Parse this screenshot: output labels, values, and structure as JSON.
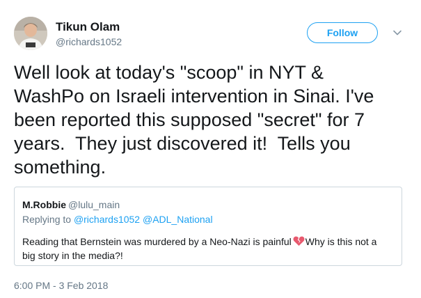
{
  "author": {
    "display_name": "Tikun Olam",
    "handle": "@richards1052",
    "avatar_icon": "profile-photo"
  },
  "actions": {
    "follow_label": "Follow",
    "more_icon": "chevron-down-icon"
  },
  "tweet": {
    "text": "Well look at today's \"scoop\" in NYT &\nWashPo on Israeli intervention in Sinai. I've\nbeen reported this supposed \"secret\" for 7\nyears.  They just discovered it!  Tells you\nsomething.",
    "timestamp": "6:00 PM - 3 Feb 2018"
  },
  "quoted_tweet": {
    "display_name": "M.Robbie",
    "handle": "@lulu_main",
    "replying_prefix": "Replying to",
    "replying_to": [
      "@richards1052",
      "@ADL_National"
    ],
    "text_before_emoji": "Reading that Bernstein was murdered by a Neo-Nazi is painful",
    "emoji_icon": "broken-heart-icon",
    "text_after_emoji": "Why is this not a big story in the media?!"
  },
  "colors": {
    "accent": "#1da1f2",
    "secondary_text": "#657786",
    "border": "#ccd6dd",
    "emoji": "#e8596e"
  }
}
